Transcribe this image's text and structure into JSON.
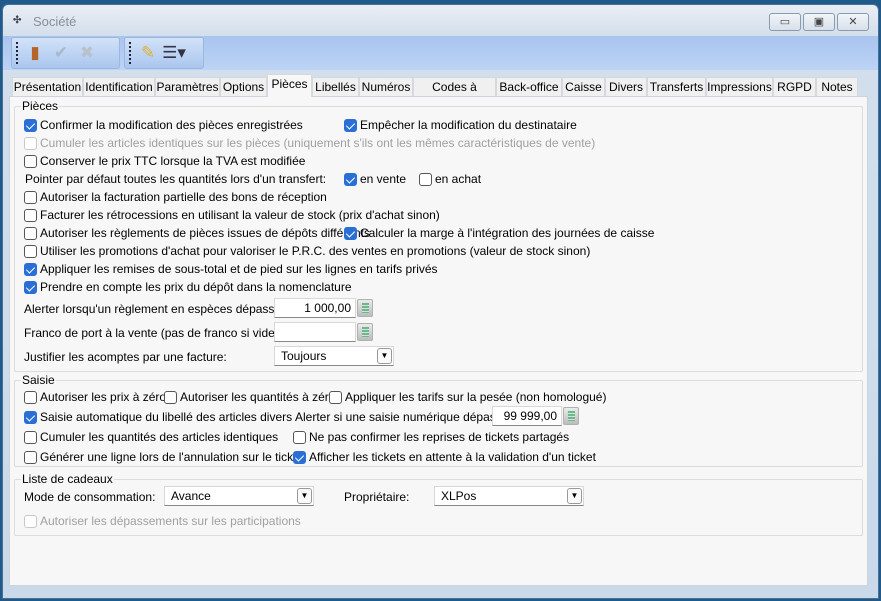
{
  "window": {
    "title": "Société",
    "minimize": "▭",
    "maximize": "▣",
    "close": "✕"
  },
  "tabs": [
    "Présentation",
    "Identification",
    "Paramètres",
    "Options",
    "Pièces",
    "Libellés",
    "Numéros",
    "Codes à barres",
    "Back-office",
    "Caisse",
    "Divers",
    "Transferts",
    "Impressions",
    "RGPD",
    "Notes"
  ],
  "active_tab": "Pièces",
  "pieces": {
    "title": "Pièces",
    "items": [
      {
        "label": "Confirmer la modification des pièces enregistrées",
        "checked": true
      },
      {
        "label": "Empêcher la modification du destinataire",
        "checked": true
      },
      {
        "label": "Cumuler les articles identiques sur les pièces (uniquement s'ils ont les mêmes caractéristiques de vente)",
        "checked": false,
        "disabled": true
      },
      {
        "label": "Conserver le prix TTC lorsque la TVA est modifiée",
        "checked": false
      },
      {
        "label": "en vente",
        "checked": true
      },
      {
        "label": "en achat",
        "checked": false
      },
      {
        "label": "Autoriser la facturation partielle des bons de réception",
        "checked": false
      },
      {
        "label": "Facturer les rétrocessions en utilisant la valeur de stock (prix d'achat sinon)",
        "checked": false
      },
      {
        "label": "Autoriser les règlements de pièces issues de dépôts différents",
        "checked": false
      },
      {
        "label": "Calculer la marge à l'intégration des journées de caisse",
        "checked": true
      },
      {
        "label": "Utiliser les promotions d'achat pour valoriser le P.R.C. des ventes en promotions (valeur de stock sinon)",
        "checked": false
      },
      {
        "label": "Appliquer les remises de sous-total et de pied sur les lignes en tarifs privés",
        "checked": true
      },
      {
        "label": "Prendre en compte les prix du dépôt dans la nomenclature",
        "checked": true
      }
    ],
    "pointer_label": "Pointer par défaut toutes les quantités lors d'un transfert:",
    "alert_cash_label": "Alerter lorsqu'un règlement en espèces dépasse:",
    "alert_cash_value": "1 000,00",
    "franco_label": "Franco de port à la vente (pas de franco si vide) :",
    "franco_value": "",
    "justify_label": "Justifier les acomptes par une facture:",
    "justify_value": "Toujours"
  },
  "saisie": {
    "title": "Saisie",
    "items": [
      {
        "label": "Autoriser les prix à zéro",
        "checked": false
      },
      {
        "label": "Autoriser les quantités à zéro",
        "checked": false
      },
      {
        "label": "Appliquer les tarifs sur la pesée (non homologué)",
        "checked": false
      },
      {
        "label": "Saisie automatique du libellé des articles divers",
        "checked": true
      },
      {
        "label": "Cumuler les quantités des articles identiques",
        "checked": false
      },
      {
        "label": "Ne pas confirmer les reprises de tickets partagés",
        "checked": false
      },
      {
        "label": "Générer une ligne lors de l'annulation sur le ticket",
        "checked": false
      },
      {
        "label": "Afficher les tickets en attente à la validation d'un ticket",
        "checked": true
      }
    ],
    "alert_numeric_label": "Alerter si une saisie numérique dépasse :",
    "alert_numeric_value": "99 999,00"
  },
  "cadeaux": {
    "title": "Liste de cadeaux",
    "mode_label": "Mode de consommation:",
    "mode_value": "Avance",
    "owner_label": "Propriétaire:",
    "owner_value": "XLPos",
    "items": [
      {
        "label": "Autoriser les dépassements sur les participations",
        "checked": false,
        "disabled": true
      }
    ]
  }
}
